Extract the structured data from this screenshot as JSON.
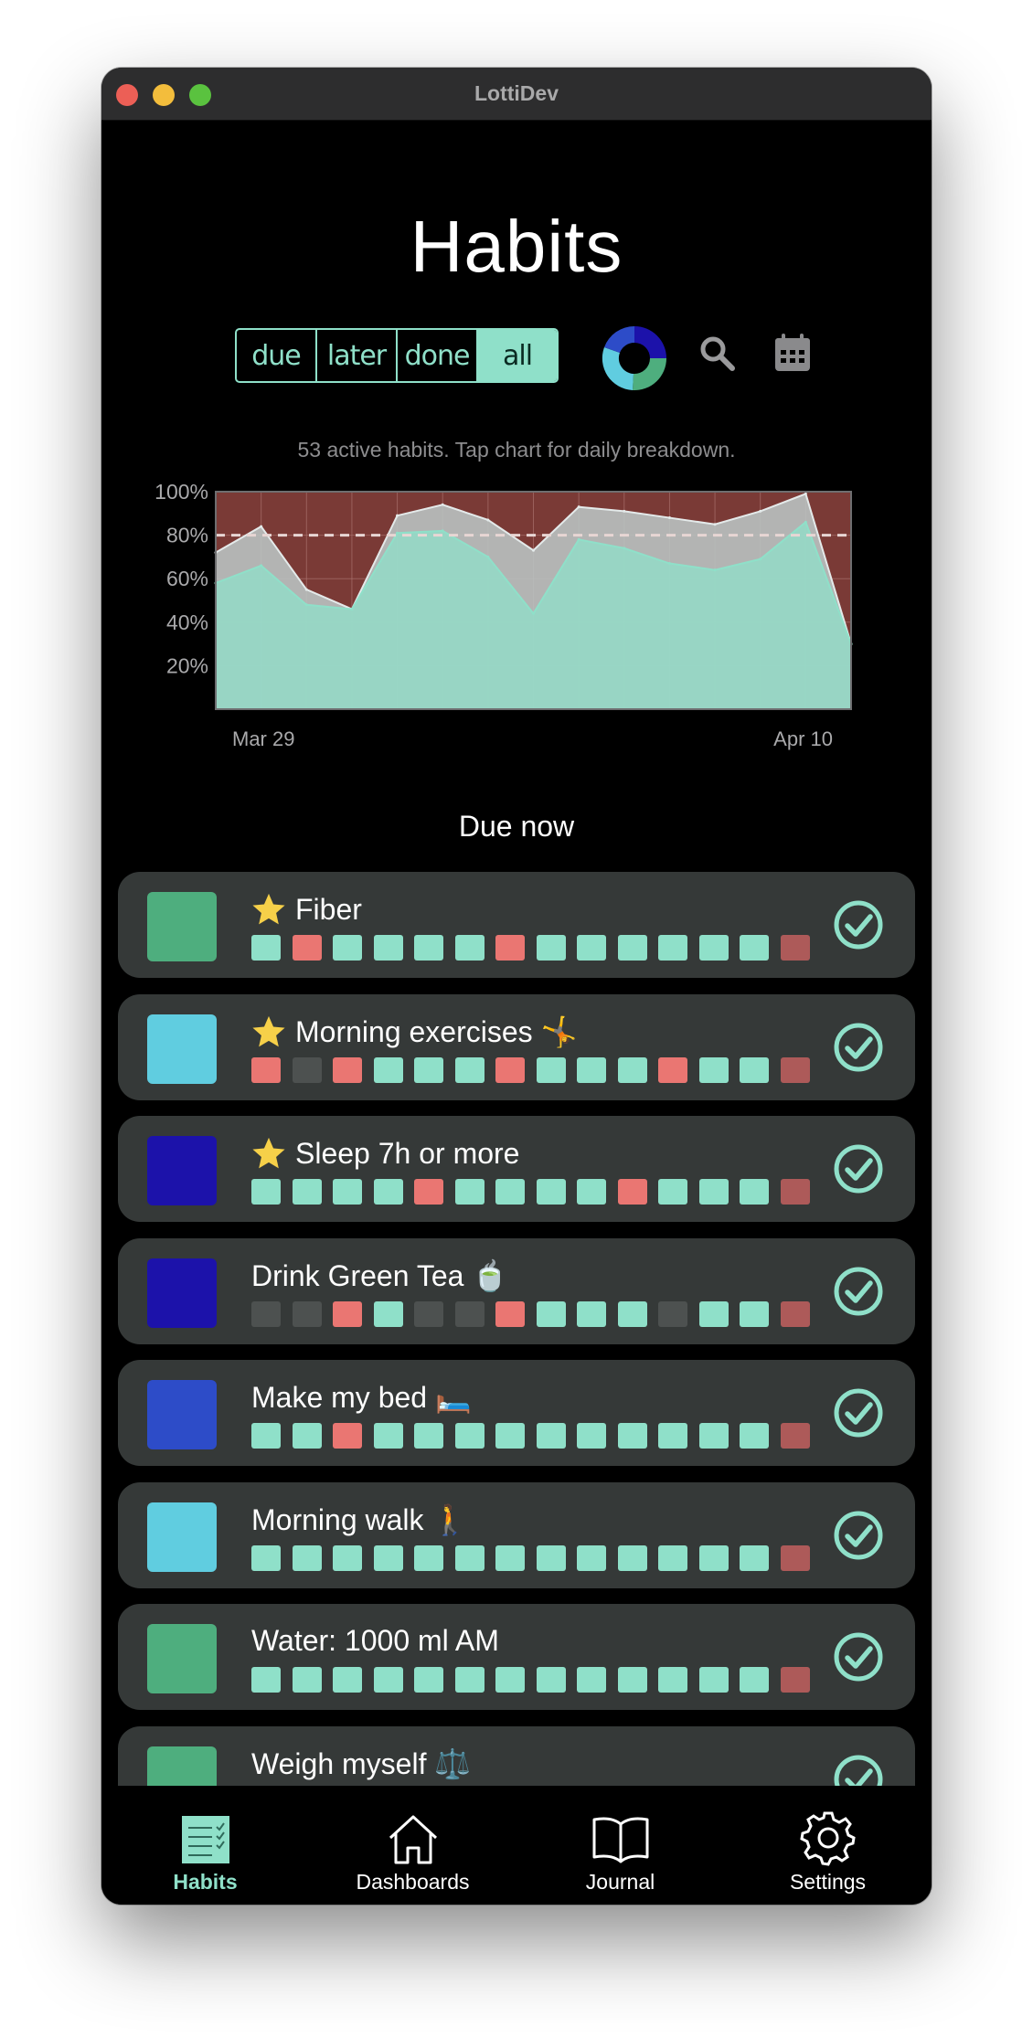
{
  "window": {
    "title": "LottiDev"
  },
  "page": {
    "title": "Habits"
  },
  "filters": {
    "options": [
      "due",
      "later",
      "done",
      "all"
    ],
    "selected": "all"
  },
  "toolbar": {
    "icons": [
      "completion-donut-icon",
      "search-icon",
      "calendar-icon"
    ]
  },
  "chart_caption": "53 active habits. Tap chart for daily breakdown.",
  "chart_data": {
    "type": "area",
    "x_labels": [
      "Mar 29",
      "Apr 10"
    ],
    "y_ticks": [
      "100%",
      "80%",
      "60%",
      "40%",
      "20%"
    ],
    "ylim": [
      0,
      100
    ],
    "target_line": 80,
    "series": [
      {
        "name": "",
        "values": [
          72,
          84,
          55,
          46,
          89,
          94,
          87,
          73,
          93,
          91,
          88,
          85,
          91,
          99,
          30
        ],
        "color": "#b9c2c1"
      },
      {
        "name": "",
        "values": [
          58,
          66,
          48,
          46,
          81,
          82,
          70,
          44,
          78,
          74,
          67,
          64,
          69,
          86,
          30
        ],
        "color": "#8fe0c9"
      }
    ],
    "grid": true,
    "background_color": "#7a3a36"
  },
  "section": {
    "title": "Due now"
  },
  "colors": {
    "success": "#8fe0c9",
    "fail": "#ea7672",
    "skip": "#4d5150",
    "today": "#ad5a59",
    "card": "#353938",
    "star": "#f6d049"
  },
  "habits": [
    {
      "name": "Fiber",
      "starred": true,
      "color": "#4eae7e",
      "days": [
        "s",
        "f",
        "s",
        "s",
        "s",
        "s",
        "f",
        "s",
        "s",
        "s",
        "s",
        "s",
        "s",
        "t"
      ]
    },
    {
      "name": "Morning exercises 🤸",
      "starred": true,
      "color": "#60cde0",
      "days": [
        "f",
        "k",
        "f",
        "s",
        "s",
        "s",
        "f",
        "s",
        "s",
        "s",
        "f",
        "s",
        "s",
        "t"
      ]
    },
    {
      "name": "Sleep 7h or more",
      "starred": true,
      "color": "#1c12aa",
      "days": [
        "s",
        "s",
        "s",
        "s",
        "f",
        "s",
        "s",
        "s",
        "s",
        "f",
        "s",
        "s",
        "s",
        "t"
      ]
    },
    {
      "name": "Drink Green Tea 🍵",
      "starred": false,
      "color": "#1c12aa",
      "days": [
        "k",
        "k",
        "f",
        "s",
        "k",
        "k",
        "f",
        "s",
        "s",
        "s",
        "k",
        "s",
        "s",
        "t"
      ]
    },
    {
      "name": "Make my bed 🛏️",
      "starred": false,
      "color": "#2d4cc8",
      "days": [
        "s",
        "s",
        "f",
        "s",
        "s",
        "s",
        "s",
        "s",
        "s",
        "s",
        "s",
        "s",
        "s",
        "t"
      ]
    },
    {
      "name": "Morning walk 🚶",
      "starred": false,
      "color": "#60cde0",
      "days": [
        "s",
        "s",
        "s",
        "s",
        "s",
        "s",
        "s",
        "s",
        "s",
        "s",
        "s",
        "s",
        "s",
        "t"
      ]
    },
    {
      "name": "Water: 1000 ml AM",
      "starred": false,
      "color": "#4eae7e",
      "days": [
        "s",
        "s",
        "s",
        "s",
        "s",
        "s",
        "s",
        "s",
        "s",
        "s",
        "s",
        "s",
        "s",
        "t"
      ]
    },
    {
      "name": "Weigh myself ⚖️",
      "starred": false,
      "color": "#4eae7e",
      "days": [
        "k",
        "f",
        "f",
        "s",
        "s",
        "s",
        "k",
        "s",
        "s",
        "s",
        "s",
        "s",
        "s",
        "t"
      ]
    }
  ],
  "tabs": [
    {
      "label": "Habits",
      "icon": "habits-checklist-icon",
      "active": true
    },
    {
      "label": "Dashboards",
      "icon": "home-icon",
      "active": false
    },
    {
      "label": "Journal",
      "icon": "open-book-icon",
      "active": false
    },
    {
      "label": "Settings",
      "icon": "gear-icon",
      "active": false
    }
  ]
}
